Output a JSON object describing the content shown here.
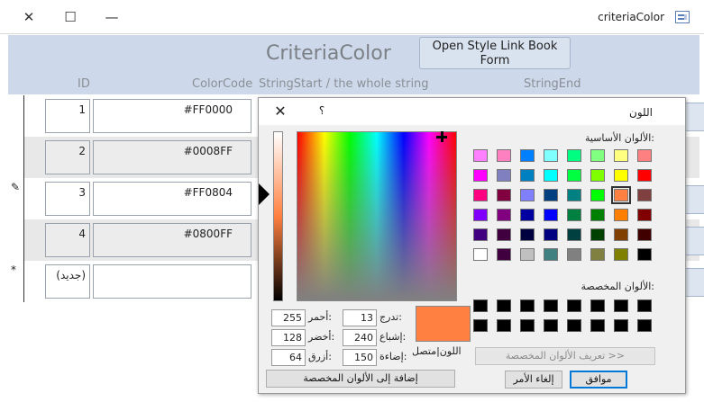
{
  "window": {
    "title": "criteriaColor",
    "controls": {
      "close": "✕",
      "maximize": "☐",
      "minimize": "—"
    }
  },
  "header": {
    "title": "CriteriaColor",
    "open_button": "Open Style Link  Book Form",
    "columns": {
      "id": "ID",
      "color_code": "ColorCode",
      "string_start": "StringStart / the whole string",
      "string_end": "StringEnd"
    }
  },
  "rows": [
    {
      "id": "1",
      "color_code": "#FF0000",
      "selector": ""
    },
    {
      "id": "2",
      "color_code": "#0008FF",
      "selector": ""
    },
    {
      "id": "3",
      "color_code": "#FF0804",
      "selector": "✎"
    },
    {
      "id": "4",
      "color_code": "#0800FF",
      "selector": ""
    },
    {
      "id": "(جديد)",
      "color_code": "",
      "selector": "*"
    }
  ],
  "dialog": {
    "title": "اللون",
    "close": "✕",
    "help": "؟",
    "basic_colors_label": "الألوان الأساسية:",
    "custom_colors_label": "الألوان المخصصة:",
    "basic_colors": [
      [
        "#ff8080",
        "#ffff80",
        "#80ff80",
        "#00ff80",
        "#80ffff",
        "#0080ff",
        "#ff80c0",
        "#ff80ff"
      ],
      [
        "#ff0000",
        "#ffff00",
        "#80ff00",
        "#00ff40",
        "#00ffff",
        "#0080c0",
        "#8080c0",
        "#ff00ff"
      ],
      [
        "#804040",
        "#ff8040",
        "#00ff00",
        "#008080",
        "#004080",
        "#8080ff",
        "#800040",
        "#ff0080"
      ],
      [
        "#800000",
        "#ff8000",
        "#008000",
        "#008040",
        "#0000ff",
        "#0000a0",
        "#800080",
        "#8000ff"
      ],
      [
        "#400000",
        "#804000",
        "#004000",
        "#004040",
        "#000080",
        "#000040",
        "#400040",
        "#400080"
      ],
      [
        "#000000",
        "#808000",
        "#808040",
        "#808080",
        "#408080",
        "#c0c0c0",
        "#400040",
        "#ffffff"
      ]
    ],
    "selected_basic": "#ff8040",
    "hue_label": "تدرج:",
    "hue": "13",
    "sat_label": "إشباع:",
    "sat": "240",
    "lum_label": "إضاءة:",
    "lum": "150",
    "red_label": "أحمر:",
    "red": "255",
    "green_label": "أخضر:",
    "green": "128",
    "blue_label": "أزرق:",
    "blue": "64",
    "solid_label": "اللون|متصل",
    "preview_color": "#ff8040",
    "define_button": "تعريف الألوان المخصصة >>",
    "add_button": "إضافة إلى الألوان المخصصة",
    "cancel_button": "إلغاء الأمر",
    "ok_button": "موافق"
  }
}
